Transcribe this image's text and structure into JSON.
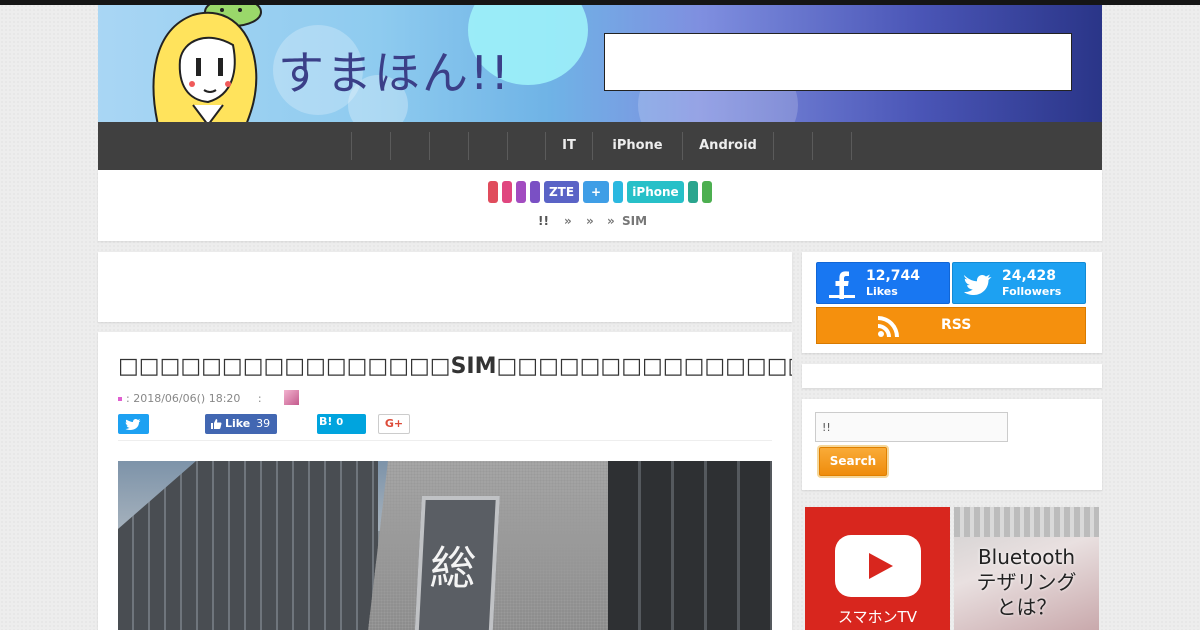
{
  "header": {
    "site_title": "すまほん!!"
  },
  "nav": {
    "items": [
      "",
      "",
      "",
      "",
      "",
      "IT",
      "iPhone",
      "Android",
      "",
      ""
    ]
  },
  "tags": [
    {
      "label": "",
      "color": "#e04c5c"
    },
    {
      "label": "",
      "color": "#e0467f"
    },
    {
      "label": "",
      "color": "#a24cc0"
    },
    {
      "label": "",
      "color": "#7a50c4"
    },
    {
      "label": "ZTE",
      "color": "#5a63c6"
    },
    {
      "label": "+",
      "color": "#3f9ee6"
    },
    {
      "label": "",
      "color": "#2bb8e0"
    },
    {
      "label": "iPhone",
      "color": "#27c0c8"
    },
    {
      "label": "",
      "color": "#2aa58e"
    },
    {
      "label": "",
      "color": "#4caf50"
    }
  ],
  "breadcrumb": {
    "home": "!!",
    "sep": "»",
    "current": "SIM"
  },
  "article": {
    "title": "□□□□□□□□□□□□□□□□SIM□□□□□□□□□□□□□□□□□□□□",
    "date_prefix": ":",
    "date": "2018/06/06() 18:20",
    "author_sep": ":",
    "share": {
      "facebook_label": "Like",
      "facebook_count": "39",
      "hatena_label": "B!",
      "hatena_count": "0",
      "gplus_label": "G+"
    },
    "hero_sign_char": "総"
  },
  "sidebar": {
    "facebook": {
      "count": "12,744",
      "label": "Likes",
      "color": "#1877f2"
    },
    "twitter": {
      "count": "24,428",
      "label": "Followers",
      "color": "#1da1f2"
    },
    "rss": {
      "label": "RSS",
      "color": "#f5900d"
    },
    "search": {
      "value": "!!",
      "button": "Search"
    },
    "thumbs": [
      {
        "caption": "スマホンTV"
      },
      {
        "caption_line1": "Bluetooth",
        "caption_line2": "テザリング",
        "caption_line3": "とは？"
      }
    ]
  }
}
